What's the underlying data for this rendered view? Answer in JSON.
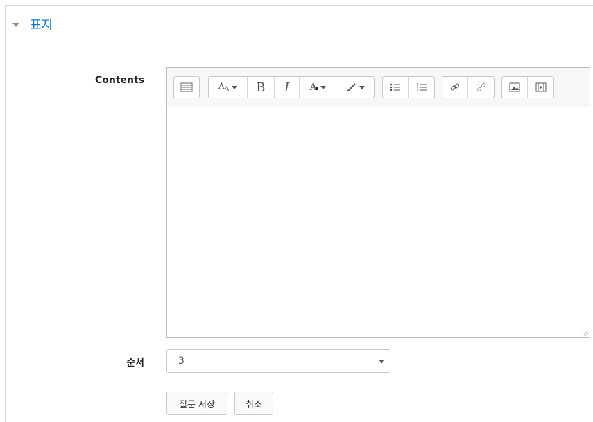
{
  "section": {
    "title": "표지",
    "collapse_icon": "chevron-down-icon"
  },
  "form": {
    "contents_label": "Contents",
    "contents_value": "",
    "order_label": "순서",
    "order_value": "3"
  },
  "toolbar": {
    "groups": [
      [
        "toggle-toolbar-icon"
      ],
      [
        "paragraph-style-icon",
        "bold-icon",
        "italic-icon",
        "font-color-icon",
        "highlight-icon"
      ],
      [
        "unordered-list-icon",
        "ordered-list-icon"
      ],
      [
        "link-icon",
        "unlink-icon"
      ],
      [
        "image-icon",
        "media-icon"
      ]
    ],
    "bold_label": "B",
    "italic_label": "I"
  },
  "buttons": {
    "save": "질문 저장",
    "cancel": "취소"
  },
  "colors": {
    "accent": "#1177d1",
    "border": "#c9c9c9"
  }
}
